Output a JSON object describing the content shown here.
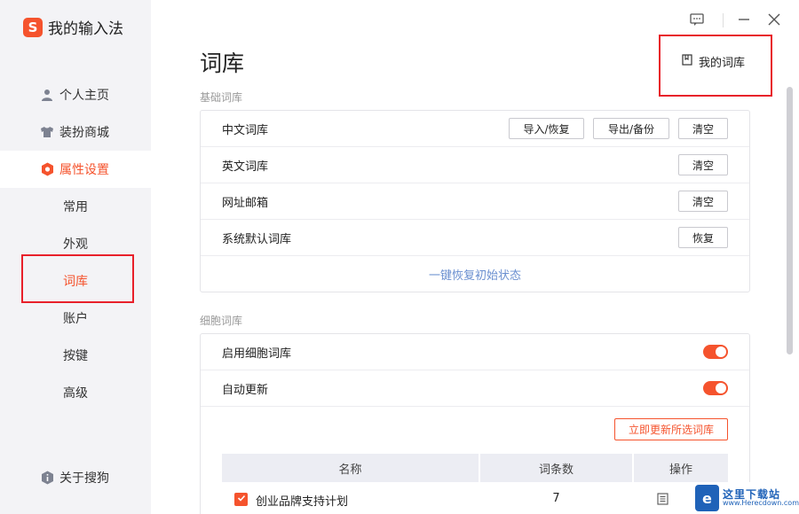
{
  "app": {
    "logo_letter": "S",
    "title": "我的输入法"
  },
  "sidebar": {
    "items": [
      {
        "label": "个人主页"
      },
      {
        "label": "装扮商城"
      },
      {
        "label": "属性设置"
      }
    ],
    "sub_items": [
      {
        "label": "常用"
      },
      {
        "label": "外观"
      },
      {
        "label": "词库"
      },
      {
        "label": "账户"
      },
      {
        "label": "按键"
      },
      {
        "label": "高级"
      }
    ],
    "about": "关于搜狗"
  },
  "header": {
    "title": "词库",
    "my_lib": "我的词库"
  },
  "basic": {
    "section_title": "基础词库",
    "rows": [
      {
        "label": "中文词库",
        "buttons": [
          "导入/恢复",
          "导出/备份",
          "清空"
        ]
      },
      {
        "label": "英文词库",
        "buttons": [
          "清空"
        ]
      },
      {
        "label": "网址邮箱",
        "buttons": [
          "清空"
        ]
      },
      {
        "label": "系统默认词库",
        "buttons": [
          "恢复"
        ]
      }
    ],
    "restore_link": "一键恢复初始状态"
  },
  "cell": {
    "section_title": "细胞词库",
    "rows": [
      {
        "label": "启用细胞词库",
        "on": true
      },
      {
        "label": "自动更新",
        "on": true
      }
    ],
    "update_button": "立即更新所选词库",
    "table": {
      "headers": [
        "名称",
        "词条数",
        "操作"
      ],
      "rows": [
        {
          "checked": true,
          "name": "创业品牌支持计划",
          "count": "7"
        }
      ]
    }
  },
  "watermark": {
    "cn": "这里下载站",
    "en": "www.Herecdown.com"
  },
  "colors": {
    "accent": "#f5532d",
    "highlight": "#e8202a",
    "link": "#6a8fd0"
  }
}
